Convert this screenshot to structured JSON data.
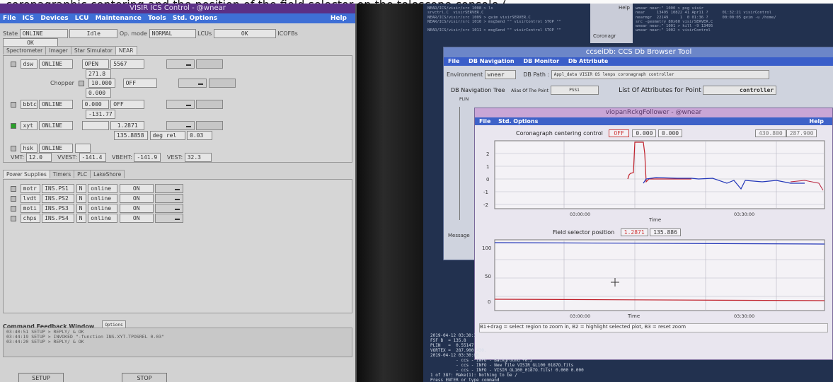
{
  "caption": "coronagraphic centering and the position of the field selector on the telescope console (",
  "left": {
    "title": "VISIR ICS Control - @wnear",
    "menu": [
      "File",
      "ICS",
      "Devices",
      "LCU",
      "Maintenance",
      "Tools",
      "Std. Options"
    ],
    "help": "Help",
    "status": {
      "state_label": "State",
      "state_value": "ONLINE",
      "sub_value": "Idle",
      "opmode_label": "Op. mode",
      "opmode_value": "NORMAL",
      "lcus_label": "LCUs",
      "lcus_value": "OK",
      "icofbs_label": "ICOFBs",
      "icofbs_value": "OK"
    },
    "tabs1": [
      "Spectrometer",
      "Imager",
      "Star Simulator",
      "NEAR"
    ],
    "rows": {
      "dsw": {
        "name": "dsw",
        "status": "ONLINE",
        "state": "OPEN",
        "value": "5567",
        "sub": "271.8"
      },
      "chopper": {
        "label": "Chopper",
        "value": "10.000",
        "state": "OFF",
        "sub": "0.000"
      },
      "bbtc": {
        "name": "bbtc",
        "status": "ONLINE",
        "value": "0.000",
        "state": "OFF",
        "sub": "-131.77"
      },
      "xyt": {
        "name": "xyt",
        "status": "ONLINE",
        "value": "1.2871",
        "value2": "135.8858",
        "unit": "deg rel",
        "step": "0.03"
      },
      "hsk": {
        "name": "hsk",
        "status": "ONLINE",
        "vmt_label": "VMT:",
        "vmt": "12.0",
        "vvest_label": "VVEST:",
        "vvest": "-141.4",
        "vbeht_label": "VBEHT:",
        "vbeht": "-141.9",
        "vest_label": "VEST:",
        "vest": "32.3"
      }
    },
    "tabs2": [
      "Power Supplies",
      "Timers",
      "PLC",
      "LakeShore"
    ],
    "power": [
      {
        "name": "motr",
        "dev": "INS.PS1",
        "flag": "N",
        "status": "online",
        "state": "ON"
      },
      {
        "name": "lvdt",
        "dev": "INS.PS2",
        "flag": "N",
        "status": "online",
        "state": "ON"
      },
      {
        "name": "moti",
        "dev": "INS.PS3",
        "flag": "N",
        "status": "online",
        "state": "ON"
      },
      {
        "name": "chps",
        "dev": "INS.PS4",
        "flag": "N",
        "status": "online",
        "state": "ON"
      }
    ],
    "feedback": {
      "title": "Command Feedback Window",
      "options": "Options",
      "lines": [
        "03:40:51 SETUP    > REPLY/ &   OK",
        "03:44:19 SETUP    > INVOKED  \"-function  INS.XYT.TPOSREL 0.03\"",
        "03:44:20 SETUP    > REPLY/ &   OK"
      ]
    },
    "buttons": {
      "setup": "SETUP",
      "stop": "STOP"
    }
  },
  "right": {
    "terminal_top": "NEAR/ICS/visir/src 1008 > ls\nsrvctrl.C  visirSERVER.C\nNEAR/ICS/visir/src 1009 > gvim visirSERVER.C\nNEAR/ICS/visir/src 1010 > msgSend \"\" visirControl STOP \"\"\n\nNEAR/ICS/visir/src 1011 > msgSend \"\" visirControl STOP \"\"",
    "terminal_right": "wnear near:\" 1000 > psg visir\nnear     13495 10822 41 Apr11 ?      01:32:21 visirControl\nnearmgr  22149     1  0 01:36 ?      00:00:05 gvim -u /home/\nsrc -geometry 80x60 visirSERVER.C\nwnear near:\" 1001 > kill -9 13495\nwnear near:\" 1002 > visirControl",
    "help_btn": "Help",
    "coronagr_label": "Coronagr",
    "dbtool": {
      "title": "ccseiDb: CCS Db Browser Tool",
      "menu": [
        "File",
        "DB Navigation",
        "DB Monitor",
        "Db Attribute"
      ],
      "env_label": "Environment",
      "env_value": "wnear",
      "path_label": "DB Path :",
      "path_value": "Appl_data VISIR OS lenps coronagraph controller",
      "nav_label": "DB Navigation Tree",
      "alias_label": "Alias Of The Point",
      "alias_value": "PSS1",
      "attr_label": "List Of Attributes for  Point",
      "attr_value": "controller",
      "plin_label": "PLIN",
      "message_label": "Message"
    },
    "follower": {
      "title": "viopanRckgFollower - @wnear",
      "menu": [
        "File",
        "Std. Options"
      ],
      "help": "Help",
      "plot1": {
        "title": "Coronagraph centering control",
        "state": "OFF",
        "v1": "0.000",
        "v2": "0.000",
        "r1": "430.800",
        "r2": "287.900",
        "xlabel": "Time",
        "ticks": [
          "03:00:00",
          "03:30:00"
        ],
        "y_ticks": [
          "2",
          "1",
          "0",
          "-1",
          "-2"
        ]
      },
      "plot2": {
        "title": "Field selector position",
        "v1": "1.2871",
        "v2": "135.886",
        "xlabel": "Time",
        "ticks": [
          "03:00:00",
          "03:30:00"
        ],
        "y_ticks": [
          "100",
          "50",
          "0"
        ]
      },
      "hint": "B1+drag = select region to zoom in, B2 = highlight selected plot, B3 = reset zoom"
    },
    "bottom_log": "2019-04-12 03:30:1\nFSF B  = 135.8\nPLIN   =  0.55147\nVORTEX =  287.900 430.\n2019-04-12 03:30:00\n          - ccs - INFO - Background +0.2\n          - ccs - INFO - New file VISIR_GL100_0187O.fits\n          - ccs - INFO - VISIR_GL100_0187O.fits! 0.000 0.000\n1 of 38?: Make(1): Nothing to be /\nPress ENTER or type command"
  },
  "colors": {
    "menu_blue": "#3e6fd6",
    "title_purple": "#5b2f86",
    "panel_gray": "#d2d2d2",
    "off_red": "#cc3333",
    "online_green": "#2aa02a"
  }
}
